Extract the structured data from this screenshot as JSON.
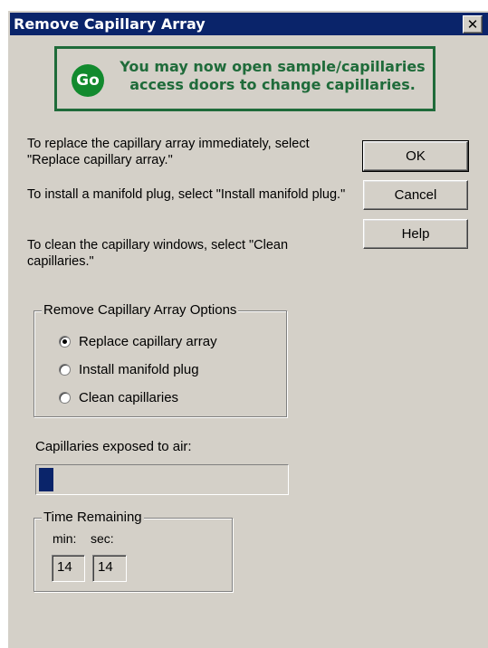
{
  "window": {
    "title": "Remove Capillary Array",
    "close_glyph": "✕"
  },
  "banner": {
    "icon_label": "Go",
    "message": "You may now open sample/capillaries access doors to change capillaries."
  },
  "instructions": [
    "To replace the capillary array immediately, select \"Replace capillary array.\"",
    "To install a manifold plug, select \"Install manifold plug.\"",
    "To clean the capillary windows, select \"Clean capillaries.\""
  ],
  "buttons": {
    "ok": "OK",
    "cancel": "Cancel",
    "help": "Help"
  },
  "options_group": {
    "title": "Remove Capillary Array Options",
    "options": [
      {
        "label": "Replace capillary array",
        "selected": true
      },
      {
        "label": "Install manifold plug",
        "selected": false
      },
      {
        "label": "Clean capillaries",
        "selected": false
      }
    ]
  },
  "exposure": {
    "label": "Capillaries exposed to air:",
    "progress_fraction": 0.06
  },
  "time_remaining": {
    "title": "Time Remaining",
    "min_label": "min:",
    "sec_label": "sec:",
    "min_value": "14",
    "sec_value": "14"
  },
  "colors": {
    "title_bar": "#0a246a",
    "banner_green": "#1f6b3a",
    "go_green": "#128a2e",
    "progress": "#0a246a"
  }
}
